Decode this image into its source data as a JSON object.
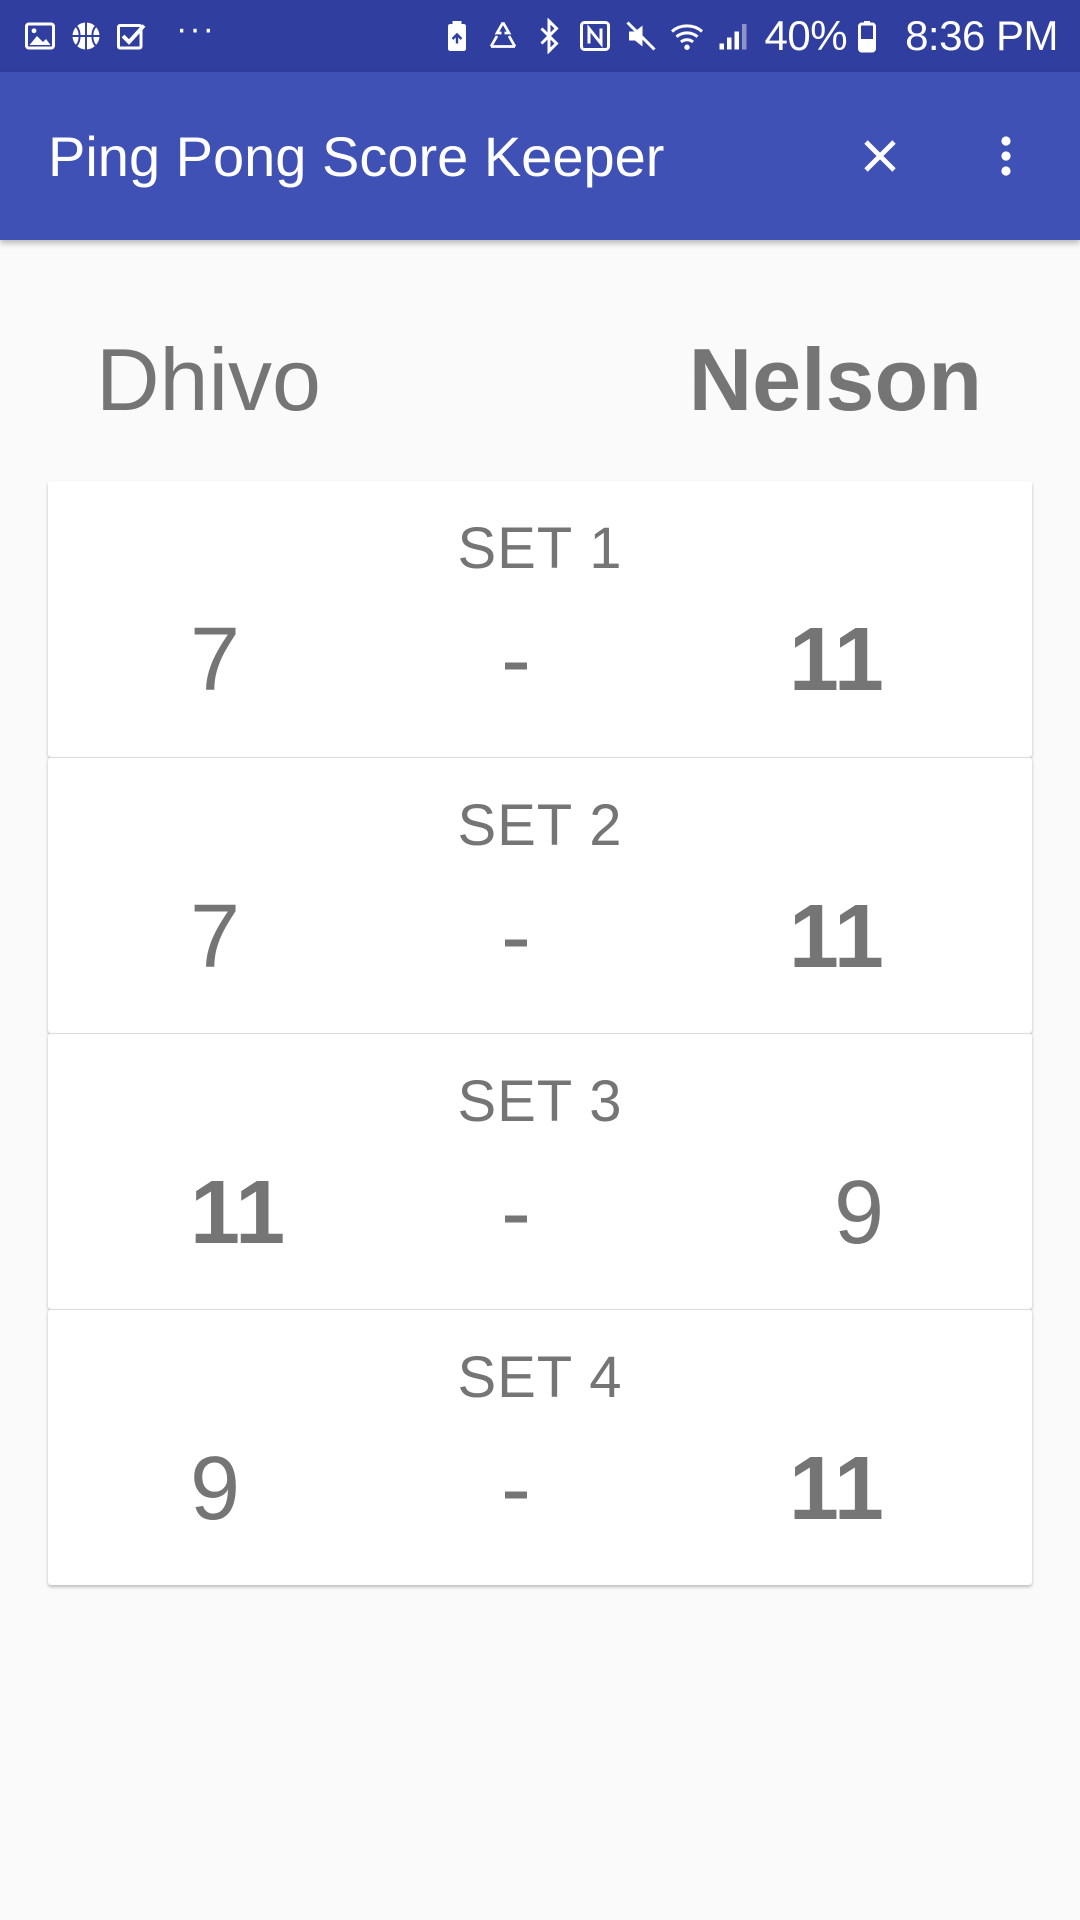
{
  "status_bar": {
    "left_icons": [
      "image-icon",
      "basketball-icon",
      "checkbox-icon"
    ],
    "more_notifications": "···",
    "right_icons": [
      "battery-saver-icon",
      "recycle-icon",
      "bluetooth-icon",
      "nfc-icon",
      "mute-icon",
      "wifi-icon",
      "signal-icon"
    ],
    "battery_percent": "40%",
    "battery_icon": "battery-icon",
    "time": "8:36 PM"
  },
  "app_bar": {
    "title": "Ping Pong Score Keeper",
    "close_icon": "close-icon",
    "menu_icon": "more-vert-icon",
    "color": "#3f51b5",
    "status_color": "#303f9f"
  },
  "players": {
    "left": "Dhivo",
    "right": "Nelson",
    "winner": "right"
  },
  "sets": [
    {
      "label": "SET 1",
      "left_score": "7",
      "separator": "-",
      "right_score": "11",
      "winner": "right"
    },
    {
      "label": "SET 2",
      "left_score": "7",
      "separator": "-",
      "right_score": "11",
      "winner": "right"
    },
    {
      "label": "SET 3",
      "left_score": "11",
      "separator": "-",
      "right_score": "9",
      "winner": "left"
    },
    {
      "label": "SET 4",
      "left_score": "9",
      "separator": "-",
      "right_score": "11",
      "winner": "right"
    }
  ]
}
